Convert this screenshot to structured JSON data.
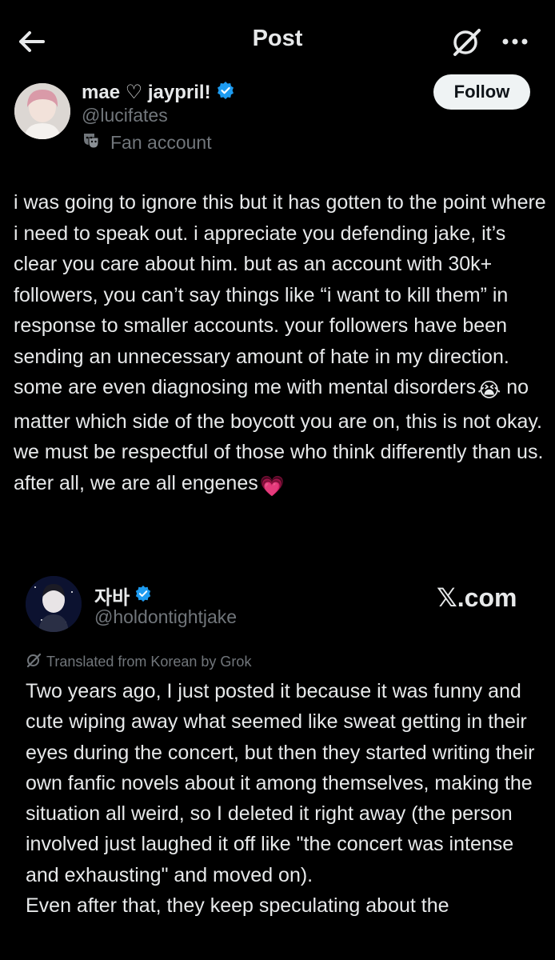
{
  "header": {
    "title": "Post",
    "back_icon": "arrow-left-icon",
    "grok_icon": "grok-icon",
    "more_icon": "more-dots-icon"
  },
  "author": {
    "name": "mae ♡ jaypril!",
    "handle": "@lucifates",
    "badge_label": "Fan account",
    "follow_label": "Follow",
    "verified_color": "#1d9bf0"
  },
  "post": {
    "text": "i was going to ignore this but it has gotten to the point where i need to speak out. i appreciate you defending jake, it’s clear you care about him. but as an account with 30k+ followers, you can’t say things like “i want to kill them” in response to smaller accounts. your followers have been sending an unnecessary amount of hate in my direction. some are even diagnosing me with mental disorders",
    "emoji_1": "😭",
    "text_2": " no matter which side of the boycott you are on, this is not okay. we must be respectful of those who think differently than us. after all, we are all engenes",
    "emoji_2": "💗"
  },
  "quoted": {
    "name": "자바",
    "handle": "@holdontightjake",
    "source": "𝕏.com",
    "translated_label": "Translated from Korean by Grok",
    "text": "Two years ago, I just posted it because it was funny and cute wiping away what seemed like sweat getting in their eyes during the concert, but then they started writing their own fanfic novels about it among themselves, making the situation all weird, so I deleted it right away (the person involved just laughed it off like \"the concert was intense and exhausting\" and moved on).",
    "text_2": "Even after that, they keep speculating about the"
  }
}
